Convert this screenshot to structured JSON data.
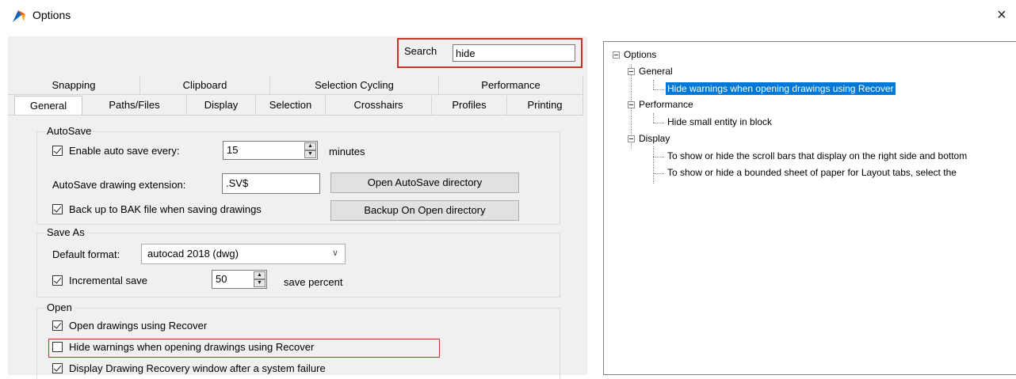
{
  "window": {
    "title": "Options",
    "close_glyph": "×",
    "icon": "app-logo-icon"
  },
  "search": {
    "label": "Search",
    "value": "hide"
  },
  "tabs": {
    "row1": [
      "Snapping",
      "Clipboard",
      "Selection Cycling",
      "Performance"
    ],
    "row2": [
      "General",
      "Paths/Files",
      "Display",
      "Selection",
      "Crosshairs",
      "Profiles",
      "Printing"
    ],
    "active": "General"
  },
  "autosave": {
    "title": "AutoSave",
    "enable_label": "Enable auto save every:",
    "enable_checked": true,
    "interval_value": "15",
    "interval_unit": "minutes",
    "extension_label": "AutoSave drawing extension:",
    "extension_value": ".SV$",
    "open_dir_button": "Open AutoSave directory",
    "bak_label": "Back up to BAK file when saving drawings",
    "bak_checked": true,
    "backup_dir_button": "Backup On Open directory"
  },
  "saveas": {
    "title": "Save As",
    "format_label": "Default format:",
    "format_value": "autocad 2018 (dwg)",
    "incremental_label": "Incremental save",
    "incremental_checked": true,
    "percent_value": "50",
    "percent_unit": "save percent"
  },
  "open": {
    "title": "Open",
    "items": [
      {
        "label": "Open drawings using Recover",
        "checked": true
      },
      {
        "label": "Hide warnings when opening drawings using Recover",
        "checked": false
      },
      {
        "label": "Display Drawing Recovery window after a system failure",
        "checked": true
      }
    ]
  },
  "tree": {
    "root": "Options",
    "general": "General",
    "general_child": "Hide warnings when opening drawings using Recover",
    "performance": "Performance",
    "performance_child": "Hide small entity in block",
    "display": "Display",
    "display_child1": "To show or hide the scroll bars that display on the right side and bottom",
    "display_child2": "To show or hide a bounded sheet of paper for Layout tabs, select the"
  },
  "colors": {
    "highlight_border": "#c0392b",
    "selection": "#0078d7"
  }
}
